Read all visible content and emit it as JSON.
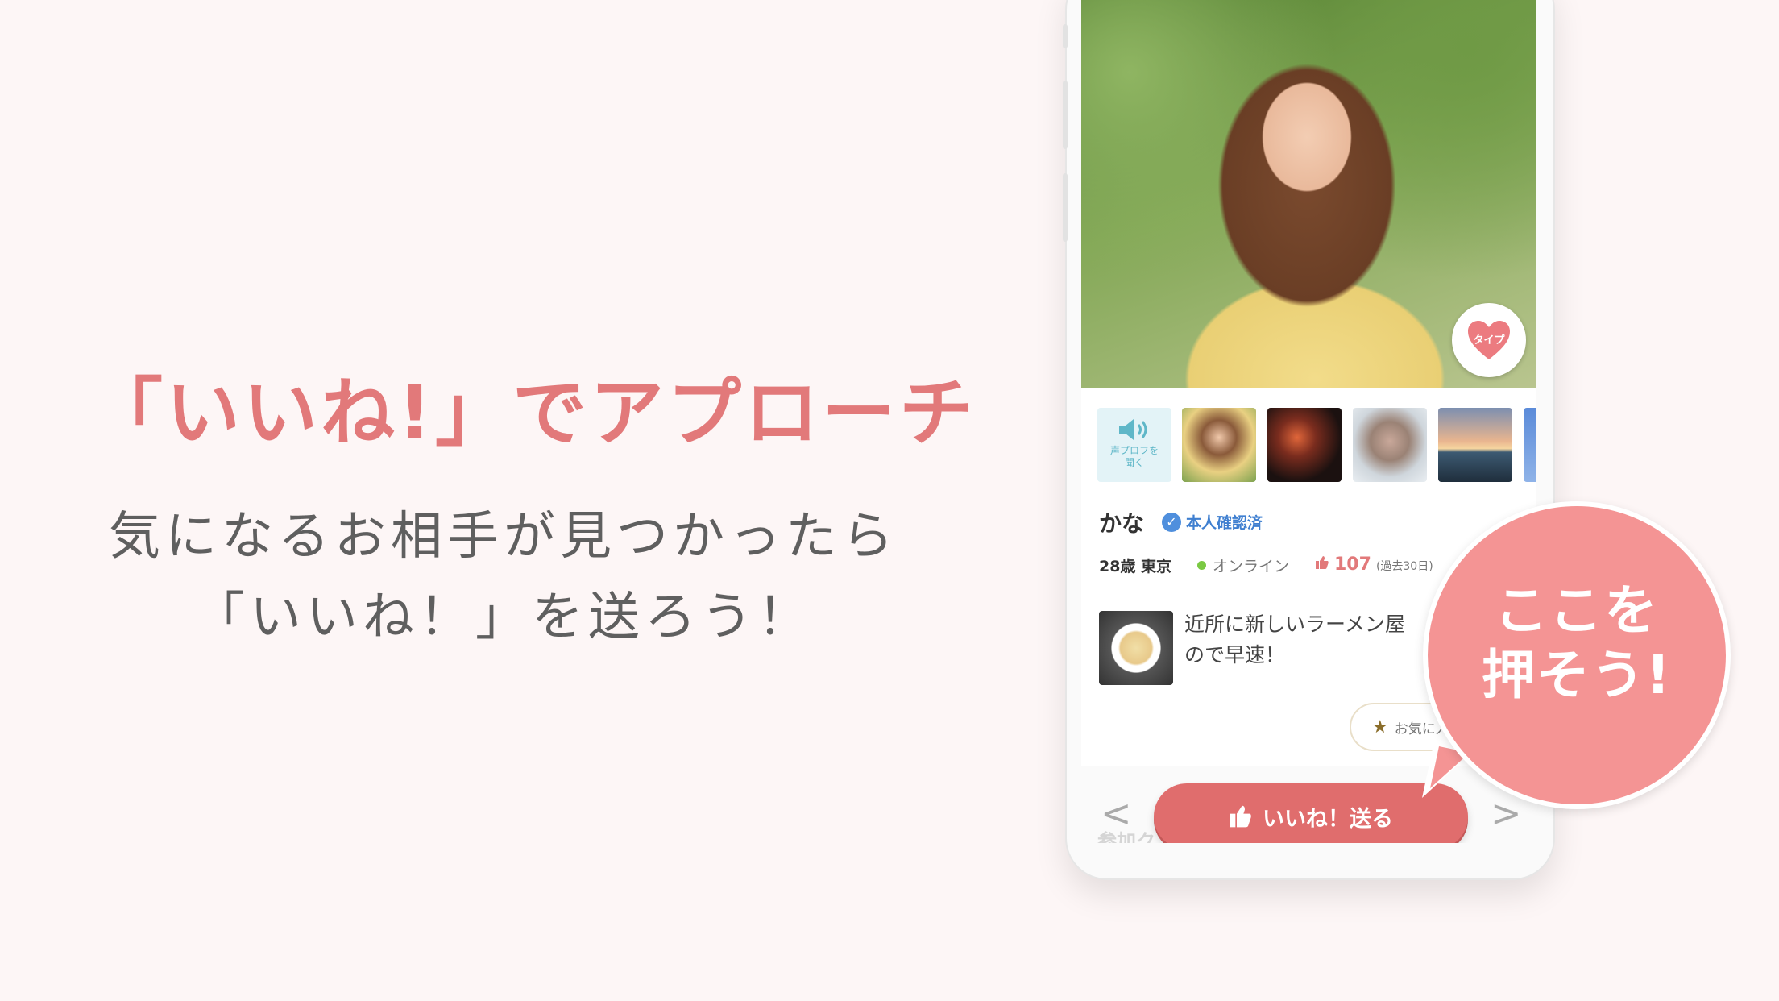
{
  "headline": "「いいね!」でアプローチ",
  "subline": {
    "line1": "気になるお相手が見つかったら",
    "line2": "「いいね！」を送ろう！"
  },
  "profile": {
    "type_badge": "タイプ",
    "voice_profile": {
      "line1": "声プロフを",
      "line2": "聞く",
      "icon": "speaker-icon"
    },
    "name": "かな",
    "verified_label": "本人確認済",
    "age_location": "28歳 東京",
    "status": "オンライン",
    "likes_count": "107",
    "likes_period": "(過去30日)",
    "post": {
      "line1": "近所に新しいラーメン屋",
      "line2": "ので早速！"
    },
    "favorite_label": "お気に入",
    "join_label": "参加ク",
    "like_button": "いいね！送る",
    "prev": "<",
    "next": ">"
  },
  "callout": {
    "line1": "ここを",
    "line2": "押そう!"
  },
  "colors": {
    "accent": "#e2797a",
    "button": "#e06d6d",
    "bubble": "#f49494",
    "online": "#7ac943",
    "verified": "#4f8fdd"
  }
}
